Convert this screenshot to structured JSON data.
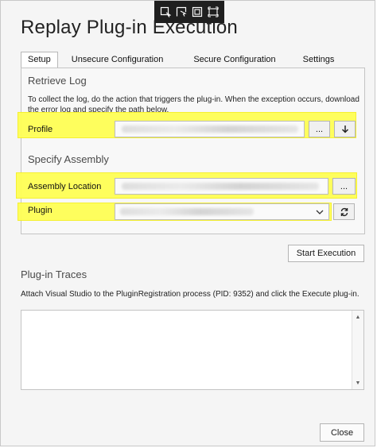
{
  "window": {
    "title": "Replay Plug-in Execution"
  },
  "tabs": [
    {
      "label": "Setup",
      "active": true
    },
    {
      "label": "Unsecure Configuration",
      "active": false
    },
    {
      "label": "Secure Configuration",
      "active": false
    },
    {
      "label": "Settings",
      "active": false
    }
  ],
  "retrieve_log": {
    "title": "Retrieve Log",
    "hint": "To collect the log, do the action that triggers the plug-in. When the exception occurs, download the error log and specify the path below.",
    "profile_label": "Profile",
    "browse_label": "...",
    "download_icon": "down-arrow-icon"
  },
  "specify_assembly": {
    "title": "Specify Assembly",
    "assembly_location_label": "Assembly Location",
    "browse_label": "...",
    "plugin_label": "Plugin",
    "refresh_icon": "refresh-icon"
  },
  "actions": {
    "start_label": "Start Execution"
  },
  "traces": {
    "title": "Plug-in Traces",
    "hint": "Attach Visual Studio to the PluginRegistration process (PID: 9352) and click the Execute plug-in."
  },
  "footer": {
    "close_label": "Close"
  },
  "colors": {
    "highlight": "#ffff55",
    "capture_bar": "#1f1f1f"
  }
}
